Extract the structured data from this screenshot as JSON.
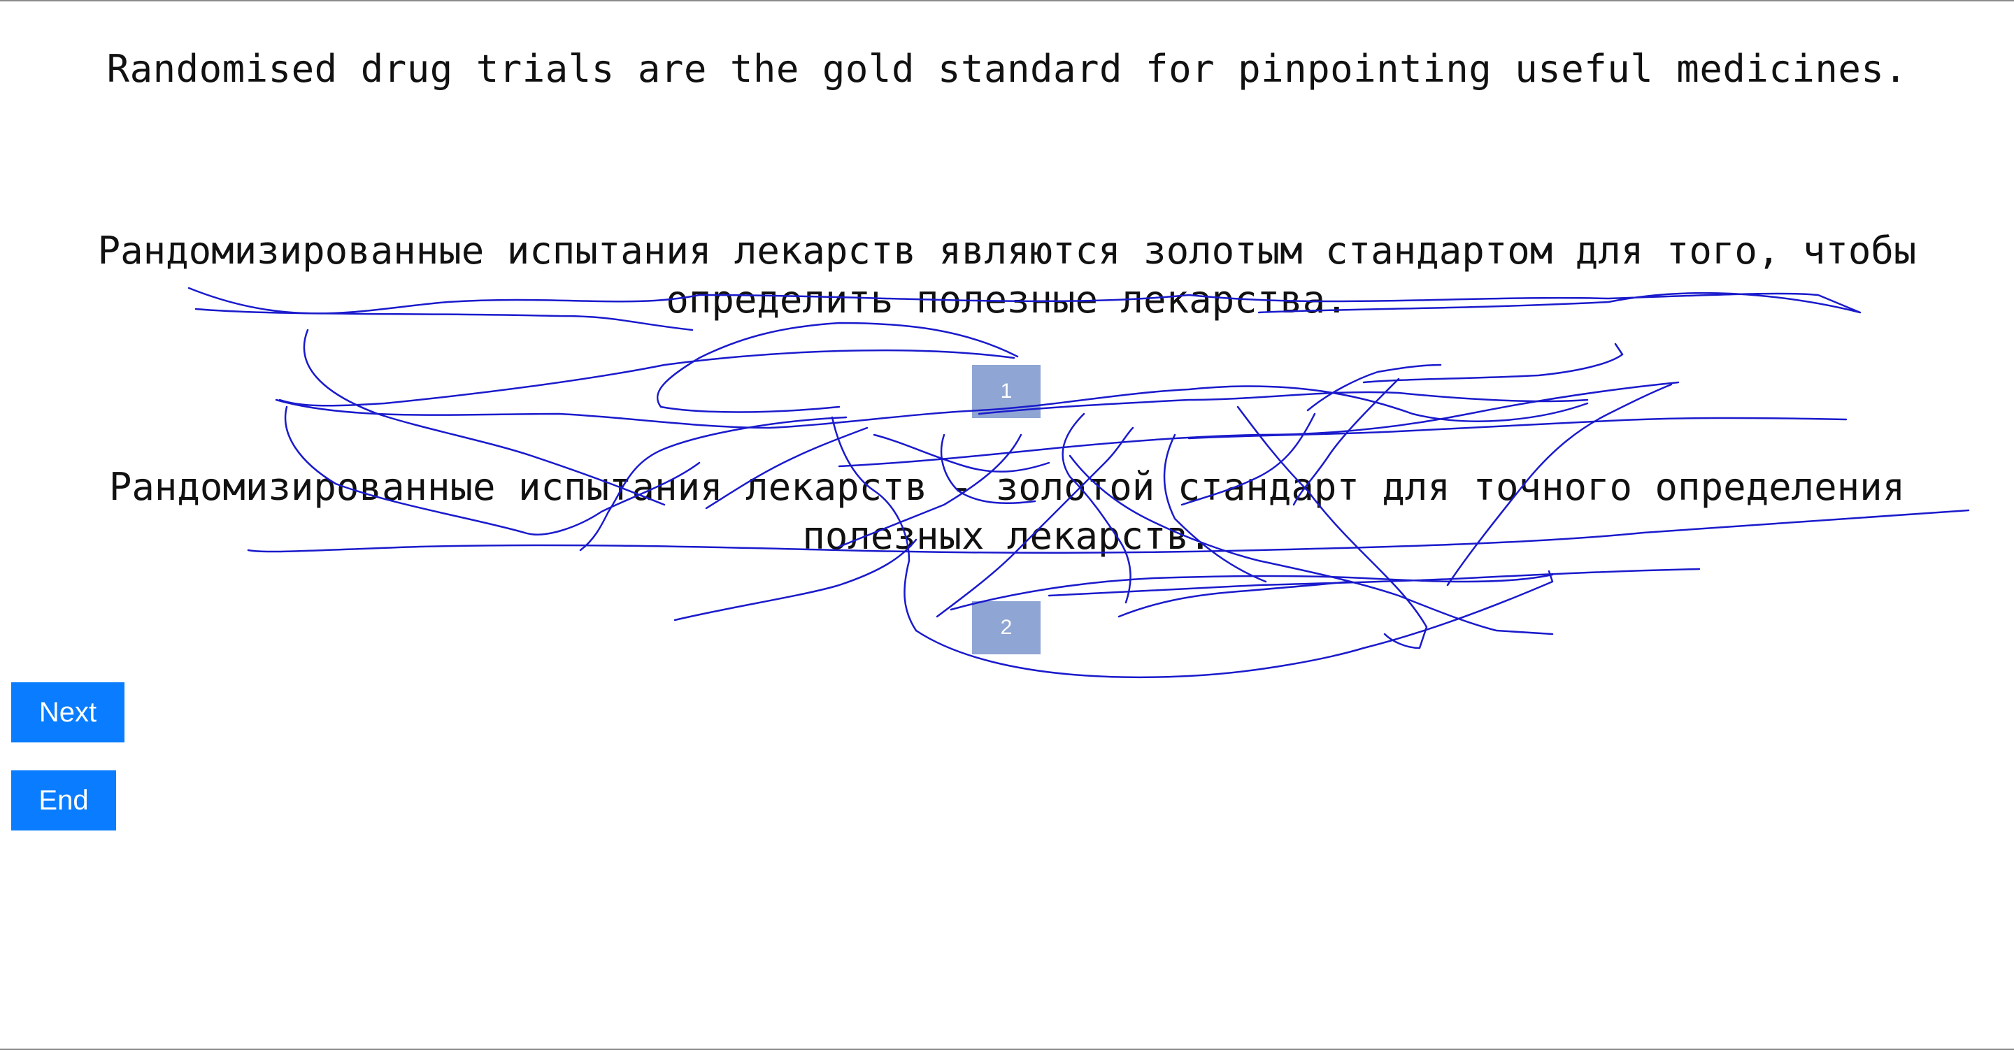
{
  "source": {
    "sentence": "Randomised drug trials are the gold standard for pinpointing useful medicines."
  },
  "translations": [
    {
      "text": "Рандомизированные испытания лекарств являются золотым стандартом для того, чтобы определить полезные лекарства.",
      "rank_label": "1"
    },
    {
      "text": "Рандомизированные испытания лекарств - золотой стандарт для точного определения полезных лекарств.",
      "rank_label": "2"
    }
  ],
  "buttons": {
    "next_label": "Next",
    "end_label": "End"
  },
  "colors": {
    "button_background": "#0a7cff",
    "rank_box_background": "#8fa5d3",
    "scribble_stroke": "#1a1acc"
  }
}
